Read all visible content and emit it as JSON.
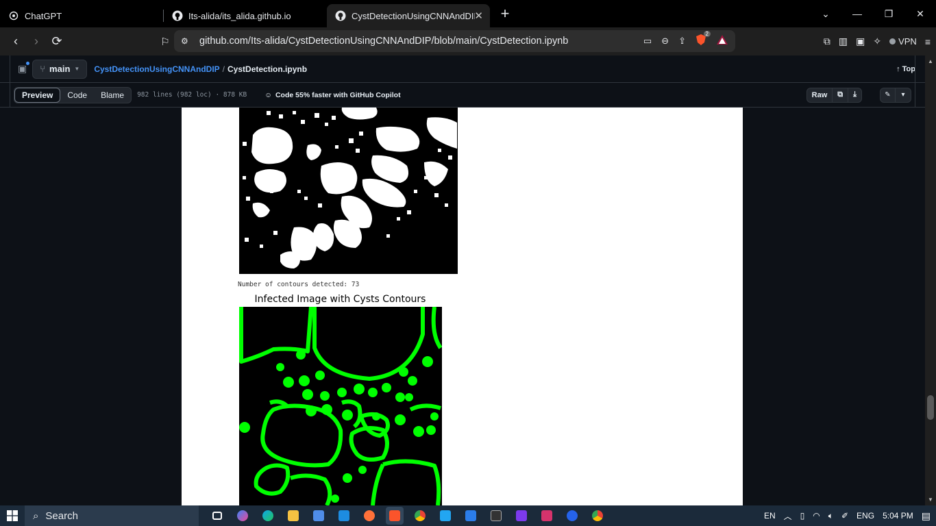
{
  "browser": {
    "tabs": [
      {
        "title": "ChatGPT",
        "icon": "chatgpt-icon",
        "active": false
      },
      {
        "title": "Its-alida/its_alida.github.io",
        "icon": "github-icon",
        "active": false
      },
      {
        "title": "CystDetectionUsingCNNAndDIP",
        "icon": "github-icon",
        "active": true
      }
    ],
    "url": "github.com/Its-alida/CystDetectionUsingCNNAndDIP/blob/main/CystDetection.ipynb",
    "vpn_label": "VPN",
    "shield_count": "2"
  },
  "github": {
    "branch": "main",
    "repo": "CystDetectionUsingCNNAndDIP",
    "file": "CystDetection.ipynb",
    "top_label": "Top",
    "tabs": [
      "Preview",
      "Code",
      "Blame"
    ],
    "active_tab": "Preview",
    "file_meta": "982 lines (982 loc) · 878 KB",
    "copilot_text": "Code 55% faster with GitHub Copilot",
    "raw_label": "Raw"
  },
  "notebook": {
    "output_text": "Number of contours detected: 73",
    "plot_title": "Infected Image with Cysts Contours"
  },
  "taskbar": {
    "search_label": "Search",
    "lang_short": "EN",
    "lang": "ENG",
    "time": "5:04 PM"
  },
  "colors": {
    "contour": "#00ff00",
    "link": "#4493f8"
  }
}
